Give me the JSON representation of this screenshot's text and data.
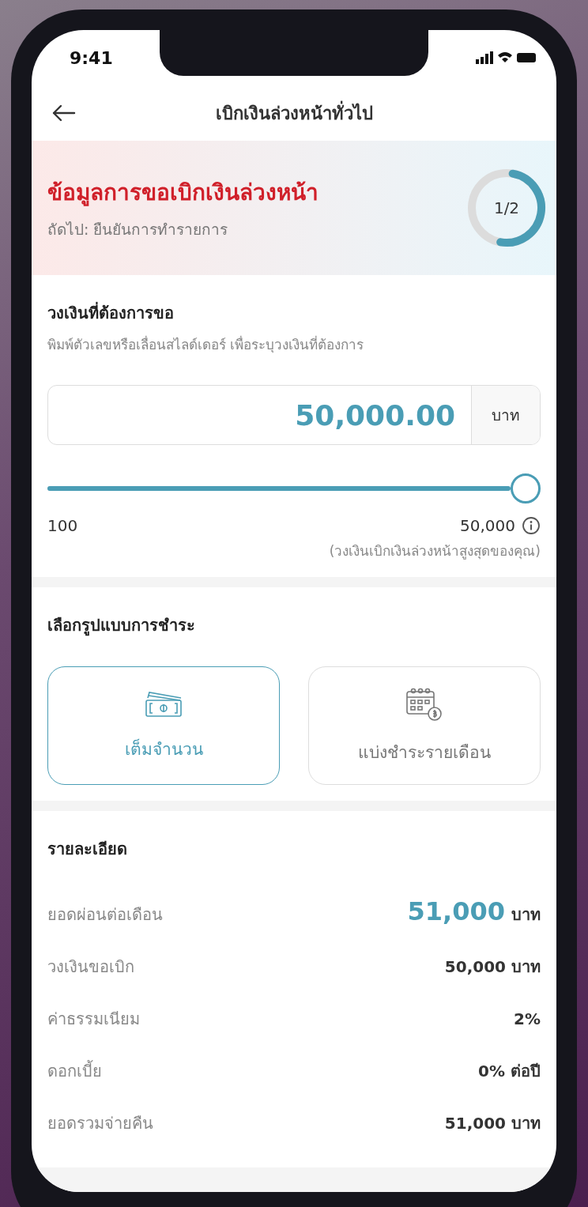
{
  "status_bar": {
    "time": "9:41"
  },
  "header": {
    "title": "เบิกเงินล่วงหน้าทั่วไป"
  },
  "banner": {
    "title": "ข้อมูลการขอเบิกเงินล่วงหน้า",
    "subtitle": "ถัดไป: ยืนยันการทำรายการ",
    "step": "1/2",
    "level": 0.5
  },
  "amount": {
    "title": "วงเงินที่ต้องการขอ",
    "hint": "พิมพ์ตัวเลขหรือเลื่อนสไลด์เดอร์ เพื่อระบุวงเงินที่ต้องการ",
    "value": "50,000.00",
    "unit": "บาท",
    "slider": {
      "level": 1.0
    },
    "min_label": "100",
    "max_label": "50,000",
    "max_note": "(วงเงินเบิกเงินล่วงหน้าสูงสุดของคุณ)"
  },
  "payment": {
    "title": "เลือกรูปแบบการชำระ",
    "options": [
      {
        "kind": "full",
        "label": "เต็มจำนวน",
        "selected": true
      },
      {
        "kind": "installment",
        "label": "แบ่งชำระรายเดือน",
        "selected": false
      }
    ]
  },
  "details": {
    "title": "รายละเอียด",
    "rows": [
      {
        "kind": "highlight",
        "label": "ยอดผ่อนต่อเดือน",
        "value": "51,000",
        "unit": "บาท"
      },
      {
        "kind": "plain",
        "label": "วงเงินขอเบิก",
        "value": "50,000 บาท"
      },
      {
        "kind": "plain",
        "label": "ค่าธรรมเนียม",
        "value": "2%"
      },
      {
        "kind": "plain",
        "label": "ดอกเบี้ย",
        "value": "0% ต่อปี"
      },
      {
        "kind": "plain",
        "label": "ยอดรวมจ่ายคืน",
        "value": "51,000 บาท"
      }
    ]
  }
}
